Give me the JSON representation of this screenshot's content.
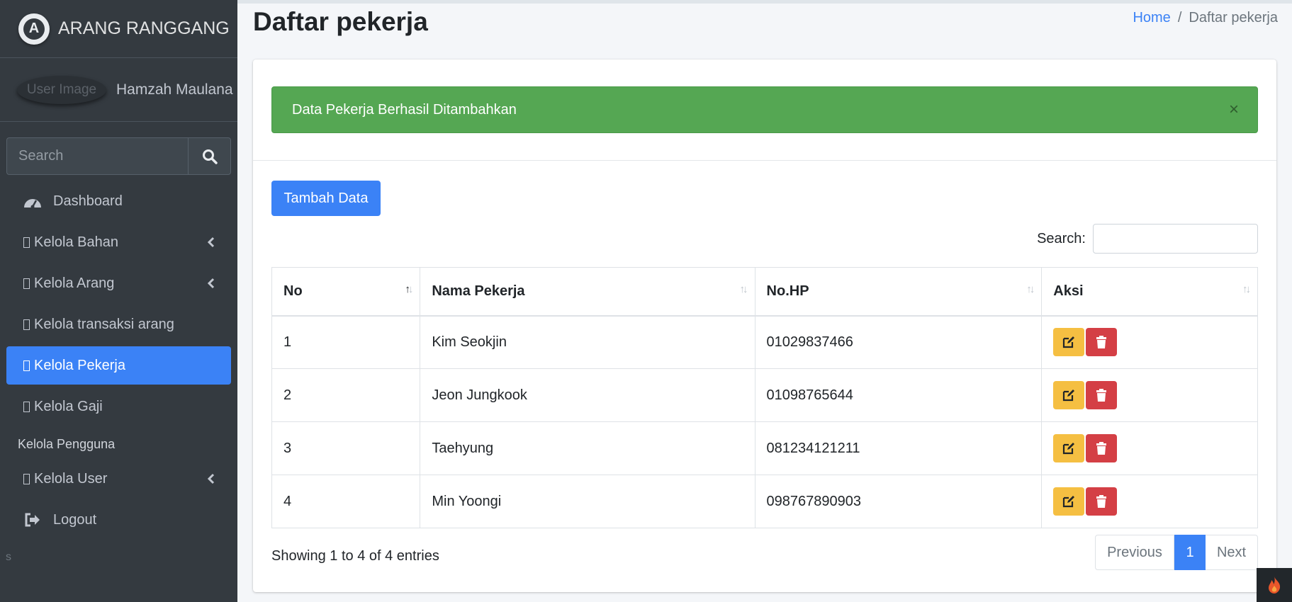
{
  "brand": {
    "name": "ARANG RANGGANG"
  },
  "user": {
    "image_alt": "User Image",
    "name": "Hamzah Maulana"
  },
  "sidebar": {
    "search_placeholder": "Search",
    "items": [
      {
        "label": "Dashboard",
        "icon": "tachometer-icon"
      },
      {
        "label": "Kelola Bahan",
        "icon": "box-glyph",
        "has_submenu": true
      },
      {
        "label": "Kelola Arang",
        "icon": "box-glyph",
        "has_submenu": true
      },
      {
        "label": "Kelola transaksi arang",
        "icon": "box-glyph"
      },
      {
        "label": "Kelola Pekerja",
        "icon": "box-glyph",
        "active": true
      },
      {
        "label": "Kelola Gaji",
        "icon": "box-glyph"
      }
    ],
    "section_header": "Kelola Pengguna",
    "items2": [
      {
        "label": "Kelola User",
        "icon": "box-glyph",
        "has_submenu": true
      },
      {
        "label": "Logout",
        "icon": "sign-out-icon"
      }
    ],
    "stray_text": "s"
  },
  "page": {
    "title": "Daftar pekerja"
  },
  "breadcrumb": {
    "home": "Home",
    "separator": "/",
    "current": "Daftar pekerja"
  },
  "alert": {
    "message": "Data Pekerja Berhasil Ditambahkan",
    "close": "×"
  },
  "toolbar": {
    "add_label": "Tambah Data"
  },
  "datatable": {
    "search_label": "Search:",
    "columns": [
      "No",
      "Nama Pekerja",
      "No.HP",
      "Aksi"
    ],
    "rows": [
      {
        "no": "1",
        "nama": "Kim Seokjin",
        "hp": "01029837466"
      },
      {
        "no": "2",
        "nama": "Jeon Jungkook",
        "hp": "01098765644"
      },
      {
        "no": "3",
        "nama": "Taehyung",
        "hp": "081234121211"
      },
      {
        "no": "4",
        "nama": "Min Yoongi",
        "hp": "098767890903"
      }
    ],
    "info": "Showing 1 to 4 of 4 entries",
    "pager": {
      "previous": "Previous",
      "current": "1",
      "next": "Next"
    }
  },
  "colors": {
    "primary": "#3b82f6",
    "success": "#55a753",
    "warning": "#f5bf42",
    "danger": "#d43f45",
    "sidebar": "#343a40"
  }
}
